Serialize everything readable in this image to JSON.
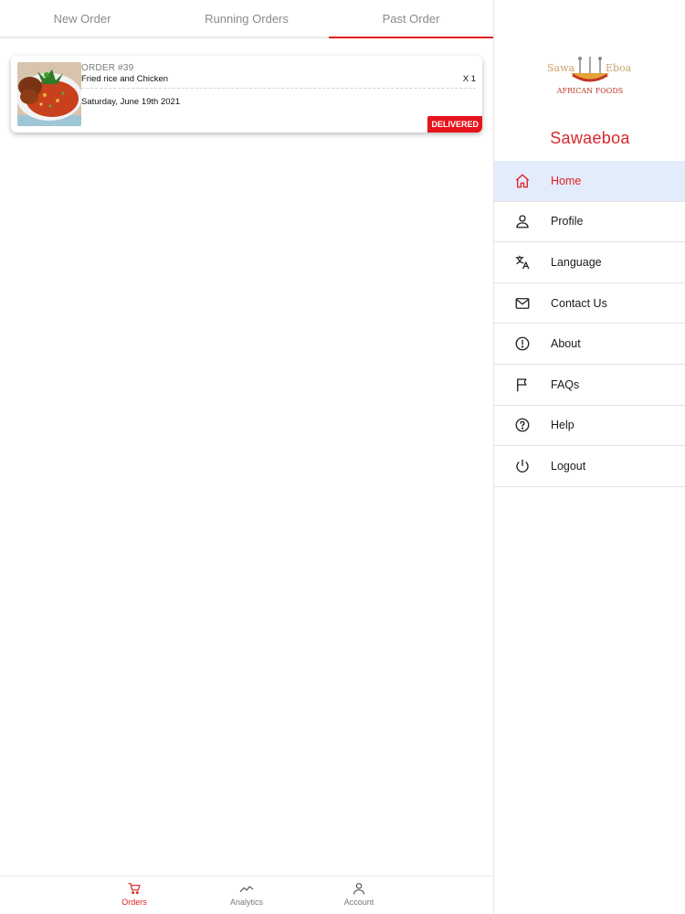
{
  "tabs": [
    {
      "label": "New Order"
    },
    {
      "label": "Running Orders"
    },
    {
      "label": "Past Order",
      "active": true
    }
  ],
  "orders": [
    {
      "order_id": "ORDER #39",
      "item_name": "Fried rice and Chicken",
      "quantity": "X 1",
      "date": "Saturday, June 19th 2021",
      "status": "DELIVERED",
      "image_icon": "fried-rice-chicken-photo"
    }
  ],
  "bottom_nav": [
    {
      "label": "Orders",
      "icon": "cart-icon",
      "active": true
    },
    {
      "label": "Analytics",
      "icon": "analytics-icon"
    },
    {
      "label": "Account",
      "icon": "account-icon"
    }
  ],
  "drawer": {
    "logo": {
      "line1_left": "Sawa",
      "line1_right": "Eboa",
      "line2": "AFRICAN FOODS"
    },
    "brand_name": "Sawaeboa",
    "menu": [
      {
        "label": "Home",
        "icon": "home-icon",
        "active": true
      },
      {
        "label": "Profile",
        "icon": "person-icon"
      },
      {
        "label": "Language",
        "icon": "translate-icon"
      },
      {
        "label": "Contact Us",
        "icon": "mail-icon"
      },
      {
        "label": "About",
        "icon": "info-icon"
      },
      {
        "label": "FAQs",
        "icon": "flag-icon"
      },
      {
        "label": "Help",
        "icon": "help-icon"
      },
      {
        "label": "Logout",
        "icon": "power-icon"
      }
    ]
  },
  "colors": {
    "accent": "#e02020",
    "active_menu_bg": "#e3ecfb",
    "badge": "#e8141b",
    "brand": "#d9272e"
  }
}
